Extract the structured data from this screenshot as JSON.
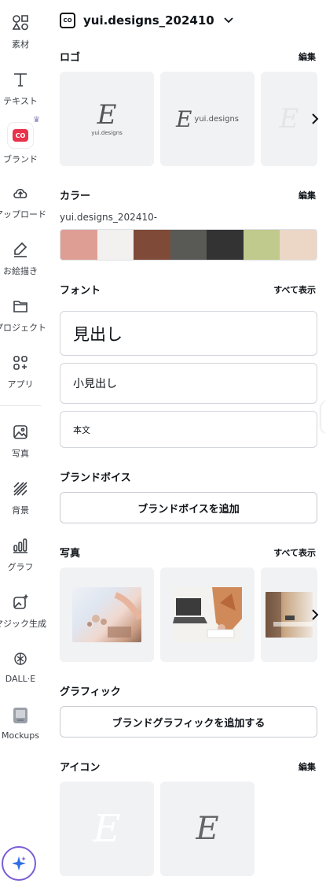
{
  "rail": {
    "items": [
      {
        "label": "素材",
        "icon": "elements-icon"
      },
      {
        "label": "テキスト",
        "icon": "text-icon"
      },
      {
        "label": "ブランド",
        "icon": "brand-icon"
      },
      {
        "label": "アップロード",
        "icon": "upload-cloud-icon"
      },
      {
        "label": "お絵描き",
        "icon": "draw-icon"
      },
      {
        "label": "プロジェクト",
        "icon": "folder-icon"
      },
      {
        "label": "アプリ",
        "icon": "apps-icon"
      },
      {
        "label": "写真",
        "icon": "photo-icon"
      },
      {
        "label": "背景",
        "icon": "background-icon"
      },
      {
        "label": "グラフ",
        "icon": "chart-icon"
      },
      {
        "label": "マジック生成",
        "icon": "magic-media-icon"
      },
      {
        "label": "DALL·E",
        "icon": "dalle-icon"
      },
      {
        "label": "Mockups",
        "icon": "mockups-icon"
      }
    ],
    "brand_badge": "CO"
  },
  "header": {
    "kit_name": "yui.designs_202410",
    "kit_logo_text": "CO"
  },
  "logos": {
    "title": "ロゴ",
    "action": "編集",
    "tiles": [
      {
        "mark": "E",
        "text": "yui.designs"
      },
      {
        "mark": "E",
        "text": "yui.designs"
      },
      {
        "mark": "E",
        "text": ""
      }
    ]
  },
  "colors": {
    "title": "カラー",
    "action": "編集",
    "palette_name": "yui.designs_202410-",
    "swatches": [
      "#df9e94",
      "#f2f1ef",
      "#7f4a37",
      "#595a55",
      "#333333",
      "#c0ca8c",
      "#ecd7c7"
    ]
  },
  "fonts": {
    "title": "フォント",
    "action": "すべて表示",
    "items": [
      {
        "label": "見出し"
      },
      {
        "label": "小見出し"
      },
      {
        "label": "本文"
      }
    ]
  },
  "brand_voice": {
    "title": "ブランドボイス",
    "button": "ブランドボイスを追加"
  },
  "photos": {
    "title": "写真",
    "action": "すべて表示"
  },
  "graphics": {
    "title": "グラフィック",
    "button": "ブランドグラフィックを追加する"
  },
  "icons": {
    "title": "アイコン",
    "action": "編集",
    "tiles": [
      {
        "mark": "E"
      },
      {
        "mark": "E"
      }
    ]
  },
  "colors_ui": {
    "accent": "#7b5cd6",
    "brand_red": "#e8334a"
  }
}
